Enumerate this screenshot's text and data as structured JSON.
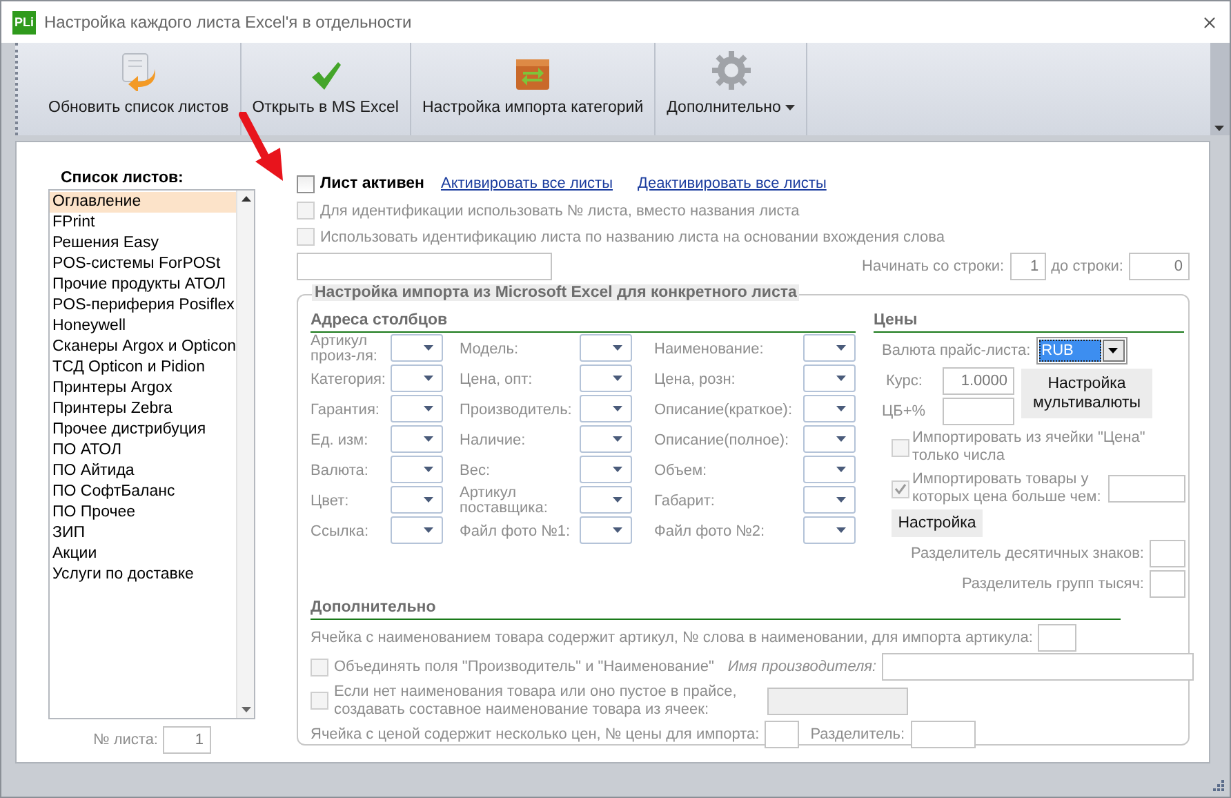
{
  "window": {
    "logo": "PLi",
    "title": "Настройка каждого листа Excel'я в отдельности"
  },
  "toolbar": {
    "buttons": [
      {
        "label": "Обновить список листов",
        "kind": "refresh",
        "dropdown": false
      },
      {
        "label": "Открыть в MS Excel",
        "kind": "check",
        "dropdown": false
      },
      {
        "label": "Настройка импорта категорий",
        "kind": "import",
        "dropdown": false
      },
      {
        "label": "Дополнительно",
        "kind": "gear",
        "dropdown": true
      }
    ]
  },
  "sheet_list": {
    "title": "Список листов:",
    "items": [
      {
        "label": "Оглавление",
        "selected": true
      },
      {
        "label": "FPrint",
        "selected": false
      },
      {
        "label": "Решения Easy",
        "selected": false
      },
      {
        "label": "POS-системы ForPOSt",
        "selected": false
      },
      {
        "label": "Прочие продукты АТОЛ",
        "selected": false
      },
      {
        "label": "POS-периферия Posiflex",
        "selected": false
      },
      {
        "label": "Honeywell",
        "selected": false
      },
      {
        "label": "Сканеры Argox и Opticon",
        "selected": false
      },
      {
        "label": "ТСД Opticon и Pidion",
        "selected": false
      },
      {
        "label": "Принтеры Argox",
        "selected": false
      },
      {
        "label": "Принтеры Zebra",
        "selected": false
      },
      {
        "label": "Прочее дистрибуция",
        "selected": false
      },
      {
        "label": "ПО АТОЛ",
        "selected": false
      },
      {
        "label": "ПО Айтида",
        "selected": false
      },
      {
        "label": "ПО СофтБаланс",
        "selected": false
      },
      {
        "label": "ПО Прочее",
        "selected": false
      },
      {
        "label": "ЗИП",
        "selected": false
      },
      {
        "label": "Акции",
        "selected": false
      },
      {
        "label": "Услуги по доставке",
        "selected": false
      }
    ],
    "number_label": "№ листа:",
    "number_value": "1"
  },
  "sheet_active": {
    "label": "Лист активен",
    "checked": false
  },
  "links": [
    "Активировать все листы",
    "Деактивировать все листы"
  ],
  "options": [
    {
      "label": "Для идентификации использовать № листа, вместо названия листа",
      "checked": false,
      "disabled": true
    },
    {
      "label": "Использовать идентификацию листа по названию листа на основании вхождения слова",
      "checked": false,
      "disabled": true
    }
  ],
  "row_range": {
    "from_label": "Начинать со строки:",
    "from_value": "1",
    "to_label": "до строки:",
    "to_value": "0"
  },
  "import_group": {
    "title": "Настройка импорта из Microsoft Excel для конкретного листа",
    "columns": {
      "title": "Адреса столбцов",
      "fields": [
        {
          "label": "Артикул произ-ля:"
        },
        {
          "label": "Модель:"
        },
        {
          "label": "Наименование:"
        },
        {
          "label": "Категория:"
        },
        {
          "label": "Цена, опт:"
        },
        {
          "label": "Цена, розн:"
        },
        {
          "label": "Гарантия:"
        },
        {
          "label": "Производитель:"
        },
        {
          "label": "Описание(краткое):"
        },
        {
          "label": "Ед. изм:"
        },
        {
          "label": "Наличие:"
        },
        {
          "label": "Описание(полное):"
        },
        {
          "label": "Валюта:"
        },
        {
          "label": "Вес:"
        },
        {
          "label": "Объем:"
        },
        {
          "label": "Цвет:"
        },
        {
          "label": "Артикул поставщика:"
        },
        {
          "label": "Габарит:"
        },
        {
          "label": "Ссылка:"
        },
        {
          "label": "Файл фото №1:"
        },
        {
          "label": "Файл фото №2:"
        }
      ]
    },
    "prices": {
      "title": "Цены",
      "currency_label": "Валюта прайс-листа:",
      "currency_value": "RUB",
      "rate_label": "Курс:",
      "rate_value": "1.0000",
      "cb_label": "ЦБ+%",
      "multicurrency_button": "Настройка мультивалюты",
      "checks": [
        {
          "label": "Импортировать из ячейки \"Цена\" только числа",
          "checked": false,
          "has_input": false
        },
        {
          "label": "Импортировать товары у которых цена больше чем:",
          "checked": true,
          "has_input": true
        }
      ],
      "settings_button": "Настройка",
      "decimal_label": "Разделитель десятичных знаков:",
      "thousands_label": "Разделитель групп тысяч:"
    },
    "extra": {
      "title": "Дополнительно",
      "article_word_label": "Ячейка с наименованием товара содержит артикул, № слова в наименовании, для импорта артикула:",
      "merge": {
        "label": "Объединять поля \"Производитель\" и \"Наименование\"",
        "checked": false,
        "field_label": "Имя производителя:"
      },
      "compose": {
        "label": "Если нет наименования товара или оно пустое в прайсе, создавать составное наименование товара из ячеек:",
        "checked": false
      },
      "multi_price_label": "Ячейка с ценой содержит несколько цен, № цены для импорта:",
      "separator_label": "Разделитель:"
    }
  }
}
